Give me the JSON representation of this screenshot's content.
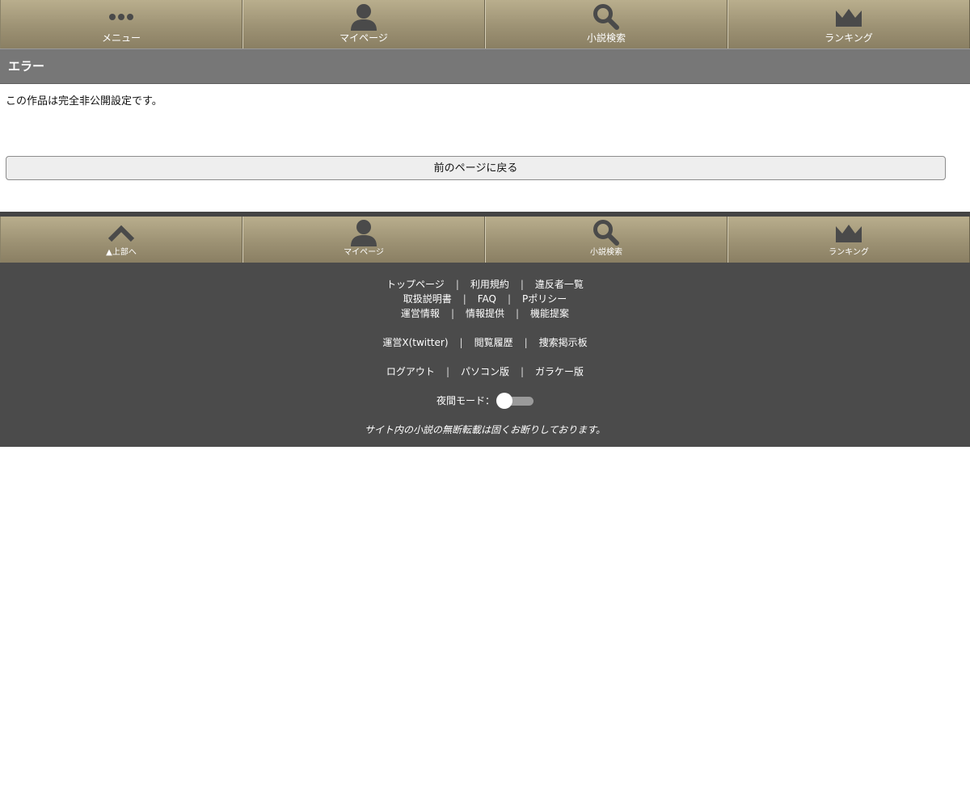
{
  "top_nav": {
    "menu": "メニュー",
    "mypage": "マイページ",
    "search": "小説検索",
    "ranking": "ランキング"
  },
  "error": {
    "title": "エラー",
    "message": "この作品は完全非公開設定です。",
    "back_button": "前のページに戻る"
  },
  "bottom_nav": {
    "top": "▲上部へ",
    "mypage": "マイページ",
    "search": "小説検索",
    "ranking": "ランキング"
  },
  "footer": {
    "row1": [
      "トップページ",
      "利用規約",
      "違反者一覧"
    ],
    "row2": [
      "取扱説明書",
      "FAQ",
      "Pポリシー"
    ],
    "row3": [
      "運営情報",
      "情報提供",
      "機能提案"
    ],
    "row4": [
      "運営X(twitter)",
      "閲覧履歴",
      "捜索掲示板"
    ],
    "row5": [
      "ログアウト",
      "パソコン版",
      "ガラケー版"
    ],
    "separator": "|",
    "night_mode_label": "夜間モード：",
    "night_mode_on": false,
    "notice": "サイト内の小説の無断転載は固くお断りしております。"
  },
  "colors": {
    "nav_gradient_top": "#b9ae8d",
    "nav_gradient_bottom": "#8a7f63",
    "icon": "#4a4a4a",
    "error_header_bg": "#777777",
    "footer_bg": "#4b4b4b"
  },
  "icons": {
    "menu": "dots-icon",
    "mypage": "person-icon",
    "search": "magnifier-icon",
    "ranking": "crown-icon",
    "top": "chevron-up-icon"
  }
}
